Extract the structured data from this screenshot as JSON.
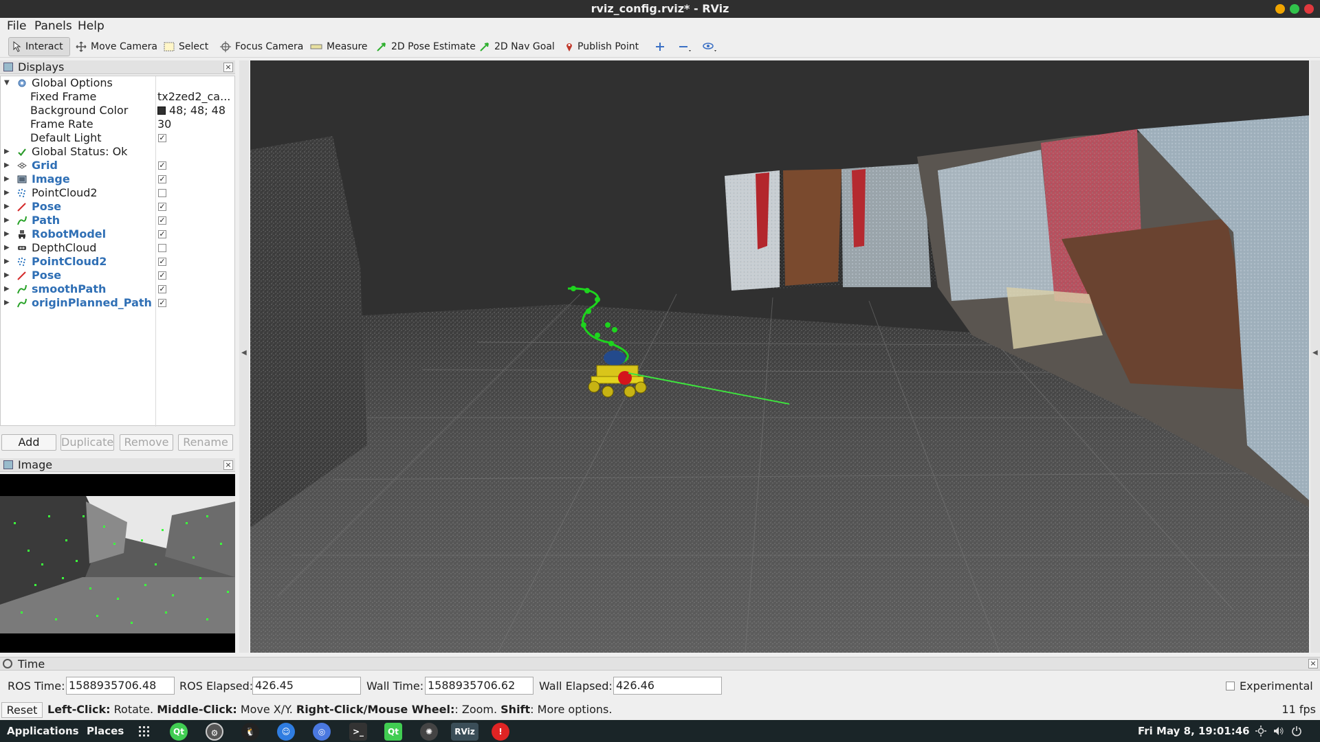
{
  "window": {
    "title": "rviz_config.rviz* - RViz"
  },
  "menu": {
    "file": "File",
    "panels": "Panels",
    "help": "Help"
  },
  "toolbar": {
    "interact": "Interact",
    "move_camera": "Move Camera",
    "select": "Select",
    "focus_camera": "Focus Camera",
    "measure": "Measure",
    "pose_estimate": "2D Pose Estimate",
    "nav_goal": "2D Nav Goal",
    "publish_point": "Publish Point"
  },
  "displays_panel": {
    "title": "Displays",
    "global_options": {
      "label": "Global Options",
      "fixed_frame_label": "Fixed Frame",
      "fixed_frame_value": "tx2zed2_ca...",
      "background_color_label": "Background Color",
      "background_color_value": "48; 48; 48",
      "background_color_hex": "#303030",
      "frame_rate_label": "Frame Rate",
      "frame_rate_value": "30",
      "default_light_label": "Default Light",
      "default_light_checked": true
    },
    "global_status": "Global Status: Ok",
    "items": [
      {
        "label": "Grid",
        "enabled": true,
        "icon": "grid-icon"
      },
      {
        "label": "Image",
        "enabled": true,
        "icon": "image-icon"
      },
      {
        "label": "PointCloud2",
        "enabled": false,
        "icon": "pointcloud-icon"
      },
      {
        "label": "Pose",
        "enabled": true,
        "icon": "pose-icon"
      },
      {
        "label": "Path",
        "enabled": true,
        "icon": "path-icon"
      },
      {
        "label": "RobotModel",
        "enabled": true,
        "icon": "robot-icon"
      },
      {
        "label": "DepthCloud",
        "enabled": false,
        "icon": "depthcloud-icon"
      },
      {
        "label": "PointCloud2",
        "enabled": true,
        "icon": "pointcloud-icon"
      },
      {
        "label": "Pose",
        "enabled": true,
        "icon": "pose-icon"
      },
      {
        "label": "smoothPath",
        "enabled": true,
        "icon": "path-icon"
      },
      {
        "label": "originPlanned_Path",
        "enabled": true,
        "icon": "path-icon"
      }
    ],
    "buttons": {
      "add": "Add",
      "duplicate": "Duplicate",
      "remove": "Remove",
      "rename": "Rename"
    }
  },
  "image_panel": {
    "title": "Image"
  },
  "time_panel": {
    "title": "Time",
    "ros_time_label": "ROS Time:",
    "ros_time_value": "1588935706.48",
    "ros_elapsed_label": "ROS Elapsed:",
    "ros_elapsed_value": "426.45",
    "wall_time_label": "Wall Time:",
    "wall_time_value": "1588935706.62",
    "wall_elapsed_label": "Wall Elapsed:",
    "wall_elapsed_value": "426.46",
    "experimental_label": "Experimental"
  },
  "status_bar": {
    "reset": "Reset",
    "left_click_key": "Left-Click:",
    "left_click_desc": "Rotate.",
    "middle_click_key": "Middle-Click:",
    "middle_click_desc": "Move X/Y.",
    "right_click_key": "Right-Click/Mouse Wheel:",
    "right_click_desc": ": Zoom.",
    "shift_key": "Shift",
    "shift_desc": ": More options.",
    "fps": "11 fps"
  },
  "taskbar": {
    "applications": "Applications",
    "places": "Places",
    "rviz_label": "RViz",
    "qt_label": "Qt",
    "clock": "Fri May  8, 19:01:46"
  }
}
